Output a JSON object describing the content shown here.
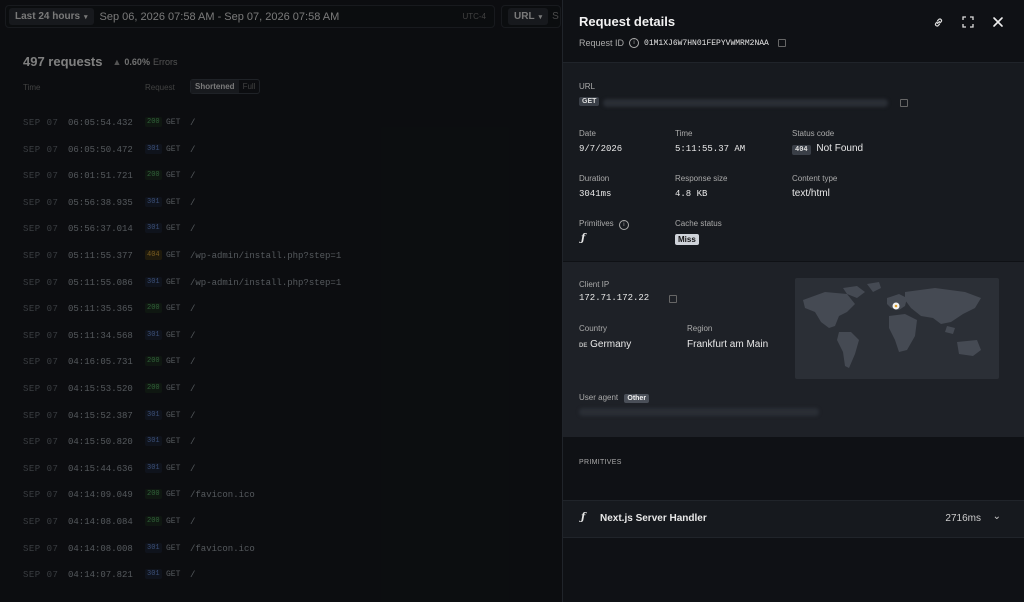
{
  "topbar": {
    "range_label": "Last 24 hours",
    "range_text": "Sep 06, 2026 07:58 AM - Sep 07, 2026 07:58 AM",
    "timezone": "UTC-4",
    "filter_label": "URL",
    "filter_cut": "S"
  },
  "summary": {
    "count": "497 requests",
    "errors": "0.60%",
    "errors_label": "Errors"
  },
  "columns": {
    "time": "Time",
    "request": "Request",
    "shortened": "Shortened",
    "full": "Full"
  },
  "requests": [
    {
      "date": "SEP 07",
      "time": "06:05:54.432",
      "status": "200",
      "method": "GET",
      "path": "/"
    },
    {
      "date": "SEP 07",
      "time": "06:05:50.472",
      "status": "301",
      "method": "GET",
      "path": "/"
    },
    {
      "date": "SEP 07",
      "time": "06:01:51.721",
      "status": "200",
      "method": "GET",
      "path": "/"
    },
    {
      "date": "SEP 07",
      "time": "05:56:38.935",
      "status": "301",
      "method": "GET",
      "path": "/"
    },
    {
      "date": "SEP 07",
      "time": "05:56:37.014",
      "status": "301",
      "method": "GET",
      "path": "/"
    },
    {
      "date": "SEP 07",
      "time": "05:11:55.377",
      "status": "404",
      "method": "GET",
      "path": "/wp-admin/install.php?step=1"
    },
    {
      "date": "SEP 07",
      "time": "05:11:55.086",
      "status": "301",
      "method": "GET",
      "path": "/wp-admin/install.php?step=1"
    },
    {
      "date": "SEP 07",
      "time": "05:11:35.365",
      "status": "200",
      "method": "GET",
      "path": "/"
    },
    {
      "date": "SEP 07",
      "time": "05:11:34.568",
      "status": "301",
      "method": "GET",
      "path": "/"
    },
    {
      "date": "SEP 07",
      "time": "04:16:05.731",
      "status": "200",
      "method": "GET",
      "path": "/"
    },
    {
      "date": "SEP 07",
      "time": "04:15:53.520",
      "status": "200",
      "method": "GET",
      "path": "/"
    },
    {
      "date": "SEP 07",
      "time": "04:15:52.387",
      "status": "301",
      "method": "GET",
      "path": "/"
    },
    {
      "date": "SEP 07",
      "time": "04:15:50.820",
      "status": "301",
      "method": "GET",
      "path": "/"
    },
    {
      "date": "SEP 07",
      "time": "04:15:44.636",
      "status": "301",
      "method": "GET",
      "path": "/"
    },
    {
      "date": "SEP 07",
      "time": "04:14:09.049",
      "status": "200",
      "method": "GET",
      "path": "/favicon.ico"
    },
    {
      "date": "SEP 07",
      "time": "04:14:08.084",
      "status": "200",
      "method": "GET",
      "path": "/"
    },
    {
      "date": "SEP 07",
      "time": "04:14:08.008",
      "status": "301",
      "method": "GET",
      "path": "/favicon.ico"
    },
    {
      "date": "SEP 07",
      "time": "04:14:07.821",
      "status": "301",
      "method": "GET",
      "path": "/"
    }
  ],
  "panel": {
    "title": "Request details",
    "request_id_label": "Request ID",
    "request_id": "01M1XJ6W7HN01FEPYVWMRM2NAA",
    "url_label": "URL",
    "url_method": "GET",
    "date_label": "Date",
    "date": "9/7/2026",
    "time_label": "Time",
    "time": "5:11:55.37 AM",
    "status_label": "Status code",
    "status_code": "404",
    "status_text": "Not Found",
    "duration_label": "Duration",
    "duration": "3041ms",
    "size_label": "Response size",
    "size": "4.8 KB",
    "content_type_label": "Content type",
    "content_type": "text/html",
    "primitives_label": "Primitives",
    "cache_label": "Cache status",
    "cache": "Miss",
    "client_ip_label": "Client IP",
    "client_ip": "172.71.172.22",
    "country_label": "Country",
    "country_code": "DE",
    "country": "Germany",
    "region_label": "Region",
    "region": "Frankfurt am Main",
    "user_agent_label": "User agent",
    "user_agent_badge": "Other",
    "primitives_section": "PRIMITIVES",
    "primitive_name": "Next.js Server Handler",
    "primitive_duration": "2716ms"
  }
}
